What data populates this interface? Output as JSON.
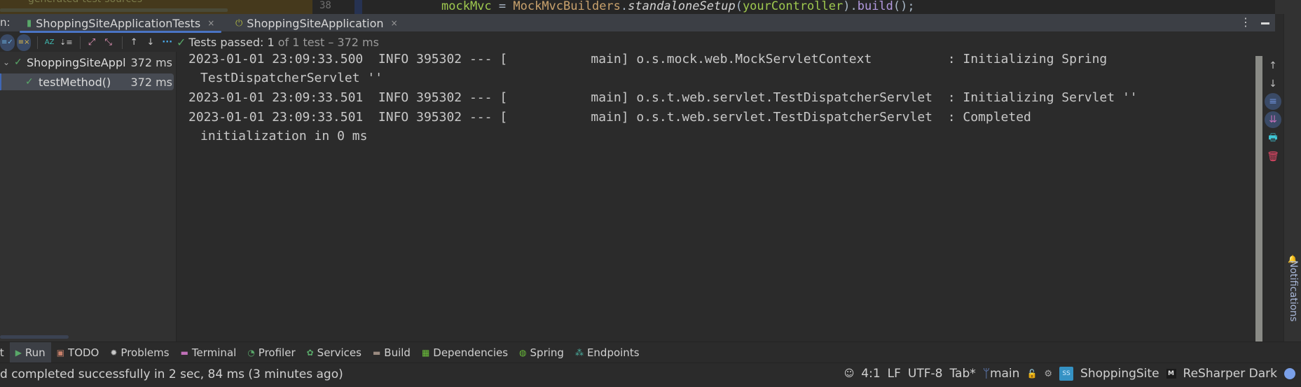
{
  "editor": {
    "faded_text": "generated-test-sources",
    "line_number": "38",
    "code": {
      "var": "mockMvc",
      "op": " = ",
      "cls": "MockMvcBuilders",
      "dot": ".",
      "method": "standaloneSetup",
      "open": "(",
      "arg": "yourController",
      "close": ").",
      "build": "build",
      "end": "();"
    }
  },
  "run_panel": {
    "prefix": "n:",
    "tabs": [
      {
        "label": "ShoppingSiteApplicationTests",
        "icon": "test-icon",
        "active": true,
        "close": "×"
      },
      {
        "label": "ShoppingSiteApplication",
        "icon": "power-icon",
        "active": false,
        "close": "×"
      }
    ],
    "menu_icon": "⋮",
    "toolbar": {
      "buttons": [
        {
          "name": "show-passed-button",
          "glyph": "≡✓"
        },
        {
          "name": "show-ignored-button",
          "glyph": "≡×"
        },
        {
          "name": "sort-alphabetically-button",
          "glyph": "AZ"
        },
        {
          "name": "sort-by-duration-button",
          "glyph": "⇣≡"
        },
        {
          "name": "expand-all-button",
          "glyph": "⤢"
        },
        {
          "name": "collapse-all-button",
          "glyph": "⤡"
        },
        {
          "name": "previous-failed-button",
          "glyph": "↑"
        },
        {
          "name": "next-failed-button",
          "glyph": "↓"
        },
        {
          "name": "more-options-button",
          "glyph": "···"
        }
      ]
    },
    "status": {
      "label": "Tests passed:",
      "count": "1",
      "of": "of 1 test",
      "sep": "–",
      "duration": "372 ms"
    },
    "tree": [
      {
        "name": "ShoppingSiteAppl",
        "time": "372 ms",
        "level": 0,
        "expanded": true
      },
      {
        "name": "testMethod()",
        "time": "372 ms",
        "level": 1,
        "selected": true
      }
    ],
    "console": [
      {
        "text": "2023-01-01 23:09:33.500  INFO 395302 --- [           main] o.s.mock.web.MockServletContext          : Initializing Spring",
        "cont": "TestDispatcherServlet ''"
      },
      {
        "text": "2023-01-01 23:09:33.501  INFO 395302 --- [           main] o.s.t.web.servlet.TestDispatcherServlet  : Initializing Servlet ''",
        "cont": null
      },
      {
        "text": "2023-01-01 23:09:33.501  INFO 395302 --- [           main] o.s.t.web.servlet.TestDispatcherServlet  : Completed",
        "cont": "initialization in 0 ms"
      }
    ],
    "right_tools": [
      {
        "name": "scroll-up-button",
        "glyph": "↑"
      },
      {
        "name": "scroll-down-button",
        "glyph": "↓"
      },
      {
        "name": "soft-wrap-button",
        "glyph": "≡"
      },
      {
        "name": "scroll-to-end-button",
        "glyph": "⇊"
      },
      {
        "name": "print-button",
        "glyph": "🖶"
      },
      {
        "name": "clear-all-button",
        "glyph": "🗑"
      }
    ]
  },
  "notifications_label": "Notifications",
  "tool_windows": [
    {
      "label": "Git",
      "icon": "git-icon",
      "glyph": "",
      "color": "#d0d0d0",
      "active": false
    },
    {
      "label": "Run",
      "icon": "run-icon",
      "glyph": "▶",
      "color": "#59a869",
      "active": true
    },
    {
      "label": "TODO",
      "icon": "todo-icon",
      "glyph": "▣",
      "color": "#c7806a",
      "active": false
    },
    {
      "label": "Problems",
      "icon": "problems-icon",
      "glyph": "✹",
      "color": "#c8c8c8",
      "active": false
    },
    {
      "label": "Terminal",
      "icon": "terminal-icon",
      "glyph": "▬",
      "color": "#c070b8",
      "active": false
    },
    {
      "label": "Profiler",
      "icon": "profiler-icon",
      "glyph": "◔",
      "color": "#59a869",
      "active": false
    },
    {
      "label": "Services",
      "icon": "services-icon",
      "glyph": "✿",
      "color": "#59a869",
      "active": false
    },
    {
      "label": "Build",
      "icon": "build-icon",
      "glyph": "▬",
      "color": "#9a8a80",
      "active": false
    },
    {
      "label": "Dependencies",
      "icon": "dependencies-icon",
      "glyph": "▦",
      "color": "#6bbf3a",
      "active": false
    },
    {
      "label": "Spring",
      "icon": "spring-icon",
      "glyph": "◍",
      "color": "#6bbf3a",
      "active": false
    },
    {
      "label": "Endpoints",
      "icon": "endpoints-icon",
      "glyph": "⁂",
      "color": "#4ab0a0",
      "active": false
    }
  ],
  "statusbar": {
    "message": "d completed successfully in 2 sec, 84 ms (3 minutes ago)",
    "position": "4:1",
    "line_sep": "LF",
    "encoding": "UTF-8",
    "indent": "Tab*",
    "branch": "main",
    "project_badge": "SS",
    "project": "ShoppingSite",
    "theme_badge": "M",
    "theme": "ReSharper Dark"
  }
}
